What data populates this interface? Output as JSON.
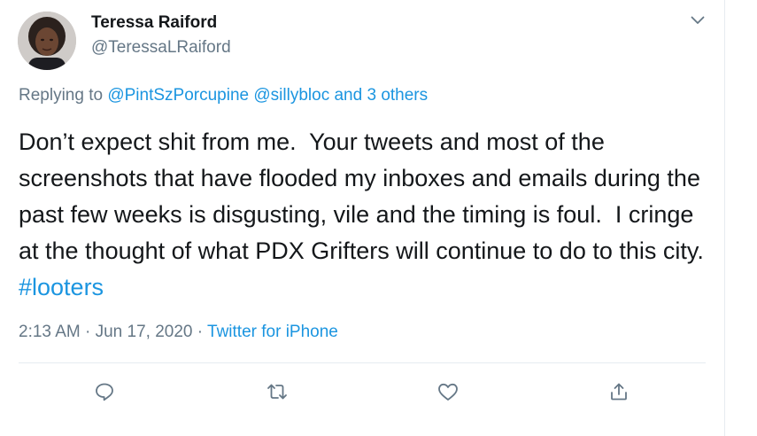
{
  "author": {
    "name": "Teressa Raiford",
    "handle": "@TeressaLRaiford"
  },
  "reply": {
    "prefix": "Replying to ",
    "mention_1": "@PintSzPorcupine",
    "mention_2": "@sillybloc",
    "connector": " and ",
    "others": "3 others"
  },
  "tweet": {
    "text": "Don’t expect shit from me.  Your tweets and most of the screenshots that have flooded my inboxes and emails during the past few weeks is disgusting, vile and the timing is foul.  I cringe at the thought of what PDX Grifters will continue to do to this city.  ",
    "hashtag": "#looters"
  },
  "meta": {
    "time": "2:13 AM",
    "separator": " · ",
    "date": "Jun 17, 2020",
    "source": "Twitter for iPhone"
  },
  "actions": {
    "icons": [
      "reply-icon",
      "retweet-icon",
      "like-icon",
      "share-icon"
    ]
  },
  "colors": {
    "link": "#1b95e0",
    "secondary_text": "#657786",
    "primary_text": "#14171a",
    "divider": "#e6ecf0"
  }
}
